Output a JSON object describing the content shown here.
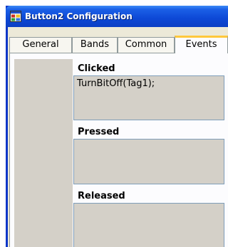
{
  "window": {
    "title": "Button2 Configuration",
    "icon": "app-window-icon"
  },
  "tabs": [
    {
      "label": "General",
      "active": false
    },
    {
      "label": "Bands",
      "active": false
    },
    {
      "label": "Common",
      "active": false
    },
    {
      "label": "Events",
      "active": true
    }
  ],
  "events": {
    "clicked": {
      "label": "Clicked",
      "value": "TurnBitOff(Tag1);"
    },
    "pressed": {
      "label": "Pressed",
      "value": ""
    },
    "released": {
      "label": "Released",
      "value": ""
    }
  },
  "colors": {
    "titlebar": "#0d48d6",
    "dialog_background": "#ece9d8",
    "active_tab_highlight": "#ffc83c",
    "code_box_background": "#d4d0c8"
  }
}
